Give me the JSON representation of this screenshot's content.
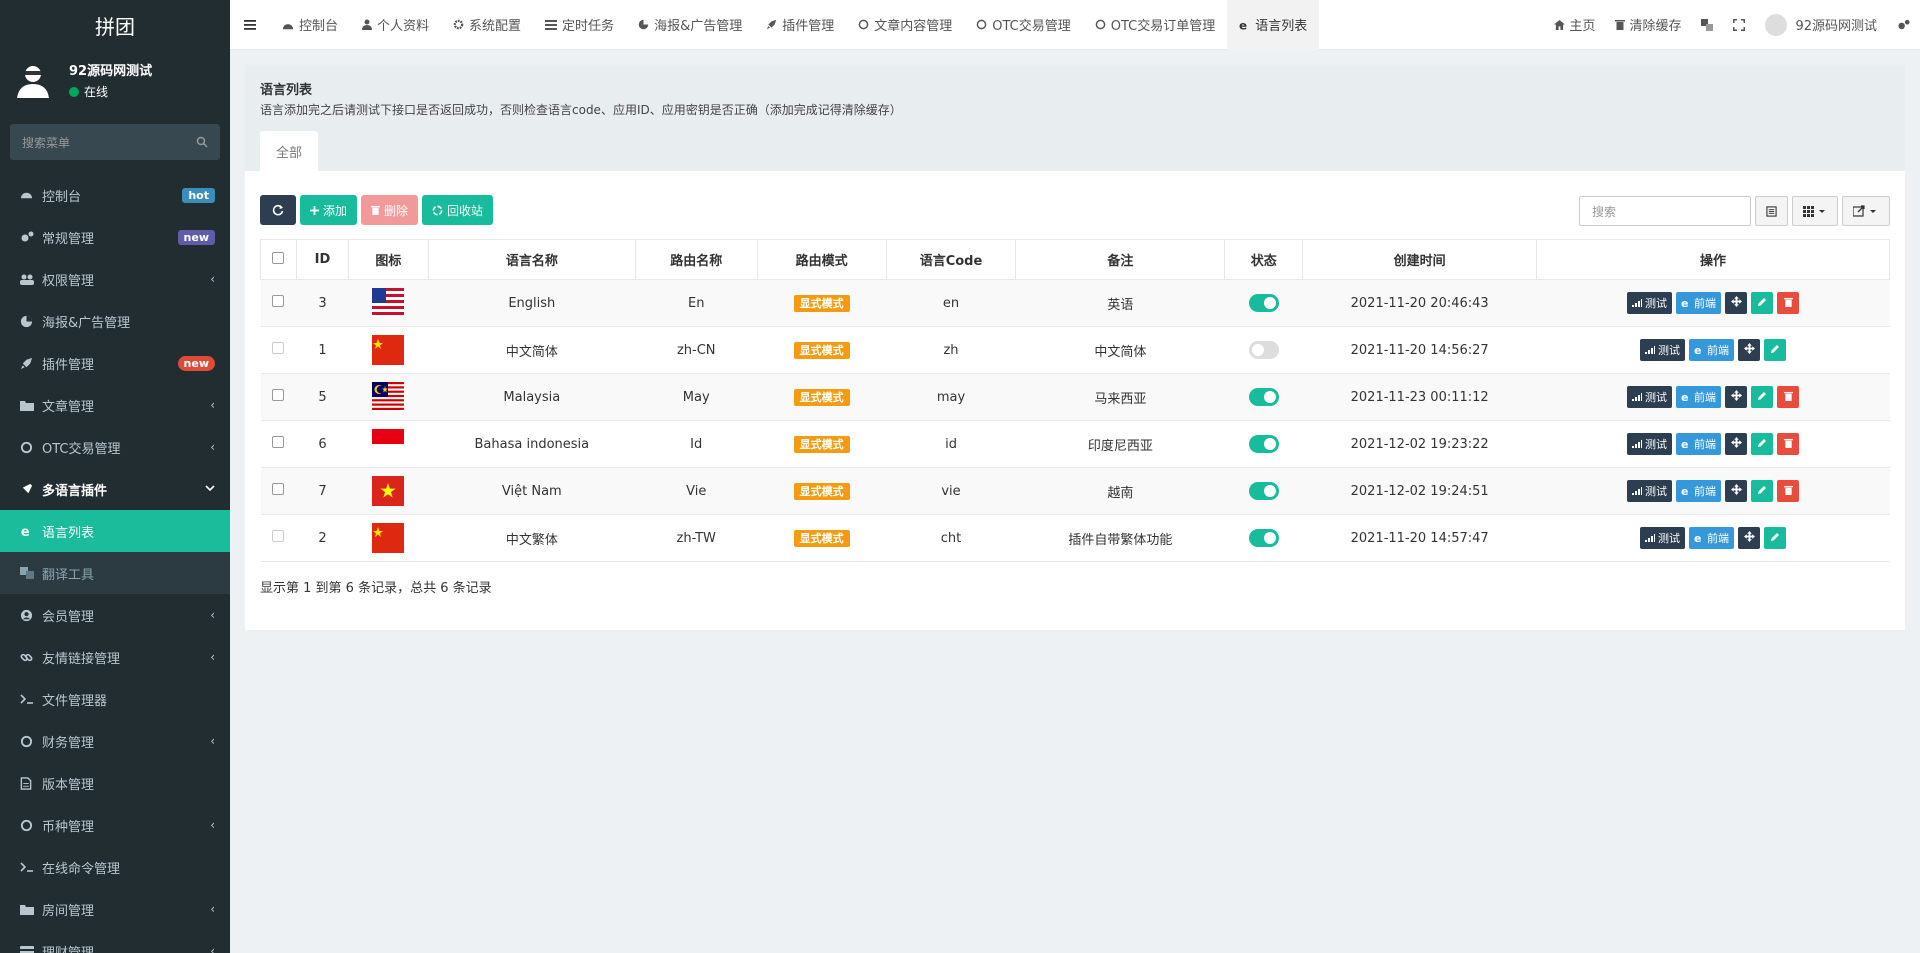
{
  "sidebar": {
    "brand": "拼团",
    "user": {
      "name": "92源码网测试",
      "status": "在线"
    },
    "search_placeholder": "搜索菜单",
    "items": [
      {
        "label": "控制台",
        "badge": "hot",
        "icon": "dashboard-icon"
      },
      {
        "label": "常规管理",
        "badge": "new",
        "icon": "cogs-icon"
      },
      {
        "label": "权限管理",
        "chevron": "‹",
        "icon": "users-icon"
      },
      {
        "label": "海报&广告管理",
        "icon": "pie-chart-icon"
      },
      {
        "label": "插件管理",
        "badge": "new",
        "icon": "rocket-icon"
      },
      {
        "label": "文章管理",
        "chevron": "‹",
        "icon": "folder-icon"
      },
      {
        "label": "OTC交易管理",
        "chevron": "‹",
        "icon": "circle-icon"
      },
      {
        "label": "多语言插件",
        "chevron": "⌄",
        "icon": "plug-icon"
      },
      {
        "label": "语言列表",
        "icon": "ie-icon"
      },
      {
        "label": "翻译工具",
        "icon": "translate-icon"
      },
      {
        "label": "会员管理",
        "chevron": "‹",
        "icon": "user-circle-icon"
      },
      {
        "label": "友情链接管理",
        "chevron": "‹",
        "icon": "link-icon"
      },
      {
        "label": "文件管理器",
        "icon": "terminal-icon"
      },
      {
        "label": "财务管理",
        "chevron": "‹",
        "icon": "circle-icon"
      },
      {
        "label": "版本管理",
        "icon": "file-icon"
      },
      {
        "label": "币种管理",
        "chevron": "‹",
        "icon": "circle-icon"
      },
      {
        "label": "在线命令管理",
        "icon": "terminal-icon"
      },
      {
        "label": "房间管理",
        "chevron": "‹",
        "icon": "folder-icon"
      },
      {
        "label": "理财管理",
        "chevron": "‹",
        "icon": "card-icon"
      }
    ]
  },
  "topnav": {
    "tabs": [
      {
        "label": "控制台",
        "icon": "dashboard-icon"
      },
      {
        "label": "个人资料",
        "icon": "user-icon"
      },
      {
        "label": "系统配置",
        "icon": "gear-icon"
      },
      {
        "label": "定时任务",
        "icon": "tasks-icon"
      },
      {
        "label": "海报&广告管理",
        "icon": "pie-chart-icon"
      },
      {
        "label": "插件管理",
        "icon": "rocket-icon"
      },
      {
        "label": "文章内容管理",
        "icon": "circle-icon"
      },
      {
        "label": "OTC交易管理",
        "icon": "circle-icon"
      },
      {
        "label": "OTC交易订单管理",
        "icon": "circle-icon"
      },
      {
        "label": "语言列表",
        "icon": "ie-icon"
      }
    ],
    "right": {
      "home": "主页",
      "clear_cache": "清除缓存",
      "user_name": "92源码网测试"
    }
  },
  "panel": {
    "title": "语言列表",
    "description": "语言添加完之后请测试下接口是否返回成功，否则检查语言code、应用ID、应用密钥是否正确（添加完成记得清除缓存）",
    "tab_all": "全部"
  },
  "toolbar": {
    "add": "添加",
    "delete": "删除",
    "recycle": "回收站",
    "search_placeholder": "搜索"
  },
  "table": {
    "headers": [
      "ID",
      "图标",
      "语言名称",
      "路由名称",
      "路由模式",
      "语言Code",
      "备注",
      "状态",
      "创建时间",
      "操作"
    ],
    "rows": [
      {
        "id": "3",
        "flag": "us",
        "name": "English",
        "route": "En",
        "mode": "显式模式",
        "code": "en",
        "remark": "英语",
        "status": "on",
        "created": "2021-11-20 20:46:43",
        "deletable": true
      },
      {
        "id": "1",
        "flag": "cn",
        "name": "中文简体",
        "route": "zh-CN",
        "mode": "显式模式",
        "code": "zh",
        "remark": "中文简体",
        "status": "off",
        "created": "2021-11-20 14:56:27",
        "deletable": false
      },
      {
        "id": "5",
        "flag": "my",
        "name": "Malaysia",
        "route": "May",
        "mode": "显式模式",
        "code": "may",
        "remark": "马来西亚",
        "status": "on",
        "created": "2021-11-23 00:11:12",
        "deletable": true
      },
      {
        "id": "6",
        "flag": "id",
        "name": "Bahasa indonesia",
        "route": "Id",
        "mode": "显式模式",
        "code": "id",
        "remark": "印度尼西亚",
        "status": "on",
        "created": "2021-12-02 19:23:22",
        "deletable": true
      },
      {
        "id": "7",
        "flag": "vn",
        "name": "Việt Nam",
        "route": "Vie",
        "mode": "显式模式",
        "code": "vie",
        "remark": "越南",
        "status": "on",
        "created": "2021-12-02 19:24:51",
        "deletable": true
      },
      {
        "id": "2",
        "flag": "cn",
        "name": "中文繁体",
        "route": "zh-TW",
        "mode": "显式模式",
        "code": "cht",
        "remark": "插件自带繁体功能",
        "status": "on",
        "created": "2021-11-20 14:57:47",
        "deletable": false
      }
    ],
    "op_test": "测试",
    "op_front": "前端"
  },
  "footer": {
    "info": "显示第 1 到第 6 条记录，总共 6 条记录"
  },
  "colors": {
    "sidebar": "#222d32",
    "accent": "#18bc9c",
    "orange": "#f39c12",
    "danger": "#e74c3c",
    "blue": "#3498db"
  }
}
